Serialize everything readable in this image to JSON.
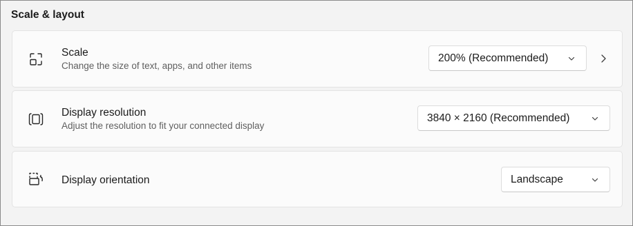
{
  "section": {
    "title": "Scale & layout"
  },
  "rows": [
    {
      "icon": "scale-icon",
      "title": "Scale",
      "subtitle": "Change the size of text, apps, and other items",
      "selected": "200% (Recommended)",
      "has_nav_chevron": true
    },
    {
      "icon": "display-resolution-icon",
      "title": "Display resolution",
      "subtitle": "Adjust the resolution to fit your connected display",
      "selected": "3840 × 2160 (Recommended)"
    },
    {
      "icon": "display-orientation-icon",
      "title": "Display orientation",
      "selected": "Landscape"
    }
  ],
  "icons": {
    "dropdown_arrow": "chevron-down-icon",
    "nav_arrow": "chevron-right-icon"
  },
  "colors": {
    "background": "#f3f3f3",
    "card": "#fbfbfb",
    "card_border": "#e3e3e3",
    "subtitle": "#5f5f5f",
    "text": "#1b1b1b"
  }
}
